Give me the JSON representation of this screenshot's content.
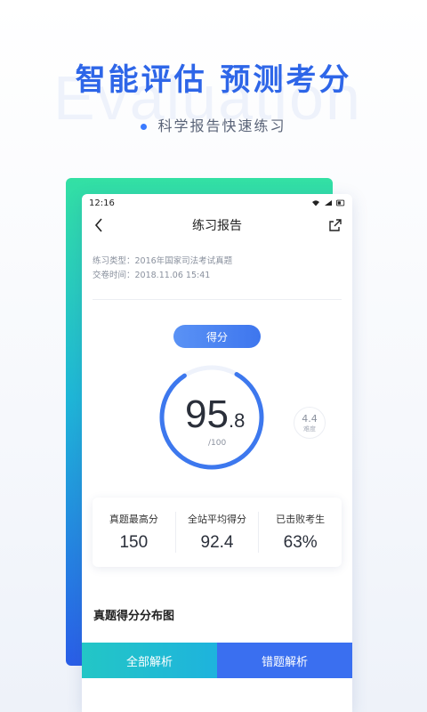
{
  "promo": {
    "watermark": "Evaluation",
    "headline": "智能评估  预测考分",
    "subline": "科学报告快速练习"
  },
  "status_bar": {
    "time": "12:16"
  },
  "nav": {
    "title": "练习报告",
    "back_icon": "chevron-left-icon",
    "share_icon": "share-icon"
  },
  "info": {
    "type_line": "练习类型：2016年国家司法考试真题",
    "time_line": "交卷时间：2018.11.06   15:41"
  },
  "score": {
    "tag": "得分",
    "main": "95",
    "decimal": ".8",
    "max": "/100",
    "progress": 0.958,
    "difficulty_value": "4.4",
    "difficulty_label": "难度"
  },
  "stats": [
    {
      "label": "真题最高分",
      "value": "150"
    },
    {
      "label": "全站平均得分",
      "value": "92.4"
    },
    {
      "label": "已击败考生",
      "value": "63%"
    }
  ],
  "distribution_title": "真题得分分布图",
  "buttons": {
    "all": "全部解析",
    "wrong": "错题解析"
  },
  "colors": {
    "accent": "#3a6ff0",
    "green": "#33e0a4",
    "ring": "#3d78ee"
  }
}
